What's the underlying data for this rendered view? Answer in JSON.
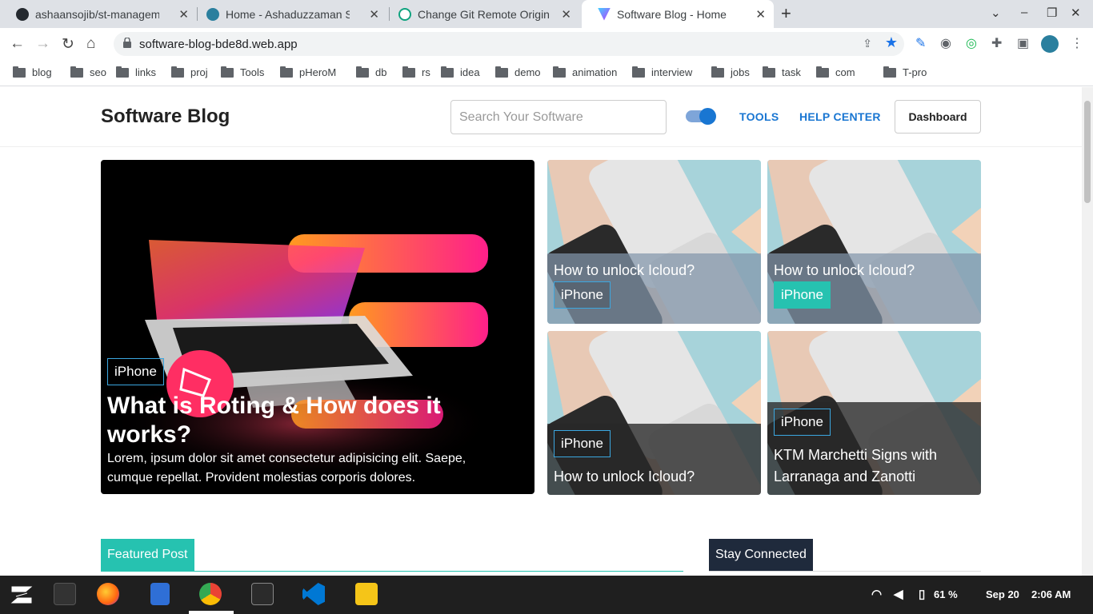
{
  "browser": {
    "tabs": [
      {
        "title": "ashaansojib/st-managemen",
        "close": "✕"
      },
      {
        "title": "Home - Ashaduzzaman Soj",
        "close": "✕"
      },
      {
        "title": "Change Git Remote Origin",
        "close": "✕"
      },
      {
        "title": "Software Blog - Home",
        "close": "✕"
      }
    ],
    "new_tab": "+",
    "url": "software-blog-bde8d.web.app",
    "bookmarks": [
      "blog",
      "seo",
      "links",
      "proj",
      "Tools",
      "pHeroM",
      "db",
      "rs",
      "idea",
      "demo",
      "animation",
      "interview",
      "jobs",
      "task",
      "com",
      "T-pro"
    ]
  },
  "site": {
    "brand": "Software Blog",
    "search_placeholder": "Search Your Software",
    "nav": {
      "tools": "TOOLS",
      "help": "HELP CENTER",
      "dashboard": "Dashboard"
    },
    "hero": {
      "tag": "iPhone",
      "title": "What is Roting & How does it works?",
      "description": "Lorem, ipsum dolor sit amet consectetur adipisicing elit. Saepe, cumque repellat. Provident molestias corporis dolores."
    },
    "cards": [
      {
        "title": "How to unlock Icloud?",
        "tag": "iPhone"
      },
      {
        "title": "How to unlock Icloud?",
        "tag": "iPhone"
      },
      {
        "title": "How to unlock Icloud?",
        "tag": "iPhone"
      },
      {
        "title": "KTM Marchetti Signs with Larranaga and Zanotti",
        "tag": "iPhone"
      }
    ],
    "sections": {
      "featured": "Featured Post",
      "stay": "Stay Connected"
    }
  },
  "taskbar": {
    "battery": "61 %",
    "date": "Sep 20",
    "time": "2:06 AM"
  },
  "colors": {
    "accent": "#26c2b0",
    "link": "#1976d2",
    "dark": "#1f2a3c"
  }
}
